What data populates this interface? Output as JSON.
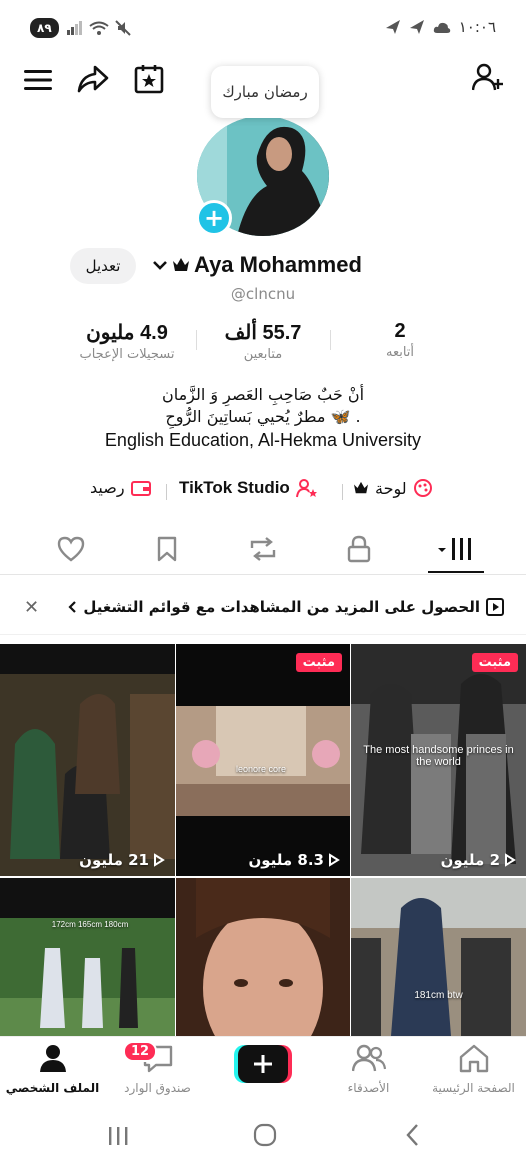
{
  "status_bar": {
    "battery": "٨٩",
    "time": "١٠:٠٦"
  },
  "bubble": {
    "text": "رمضان مبارك"
  },
  "profile": {
    "name": "Aya Mohammed",
    "handle": "@clncnu",
    "edit_label": "تعديل",
    "stats": [
      {
        "value": "4.9 مليون",
        "label": "تسجيلات الإعجاب"
      },
      {
        "value": "55.7 ألف",
        "label": "متابعين"
      },
      {
        "value": "2",
        "label": "أتابعه"
      }
    ],
    "bio": [
      "أنْ حَبٌ صَاحِبِ العَصرِ وَ الزَّمان",
      "مطرٌ يُحيي بَساتِينَ الرُّوحِ 🦋 ."
    ],
    "bio_en": "English Education, Al-Hekma University",
    "links": {
      "balance": "رصيد",
      "studio": "TikTok Studio",
      "board": "لوحة"
    }
  },
  "banner": {
    "text": "الحصول على المزيد من المشاهدات مع قوائم التشغيل"
  },
  "videos": [
    {
      "pinned": "مثبت",
      "views": "21 مليون",
      "caption": ""
    },
    {
      "pinned": "مثبت",
      "views": "8.3 مليون",
      "caption": "leonore core"
    },
    {
      "pinned": "مثبت",
      "views": "2 مليون",
      "caption": "The most handsome princes in the world"
    },
    {
      "pinned": "",
      "views": "",
      "caption": "172cm  165cm  180cm"
    },
    {
      "pinned": "",
      "views": "",
      "caption": ""
    },
    {
      "pinned": "",
      "views": "",
      "caption": "181cm btw"
    }
  ],
  "bottom_nav": {
    "home": "الصفحة الرئيسية",
    "friends": "الأصدقاء",
    "inbox": "صندوق الوارد",
    "inbox_badge": "12",
    "profile": "الملف الشخصي"
  },
  "colors": {
    "accent": "#fe2c55",
    "cyan": "#20c3e6"
  }
}
